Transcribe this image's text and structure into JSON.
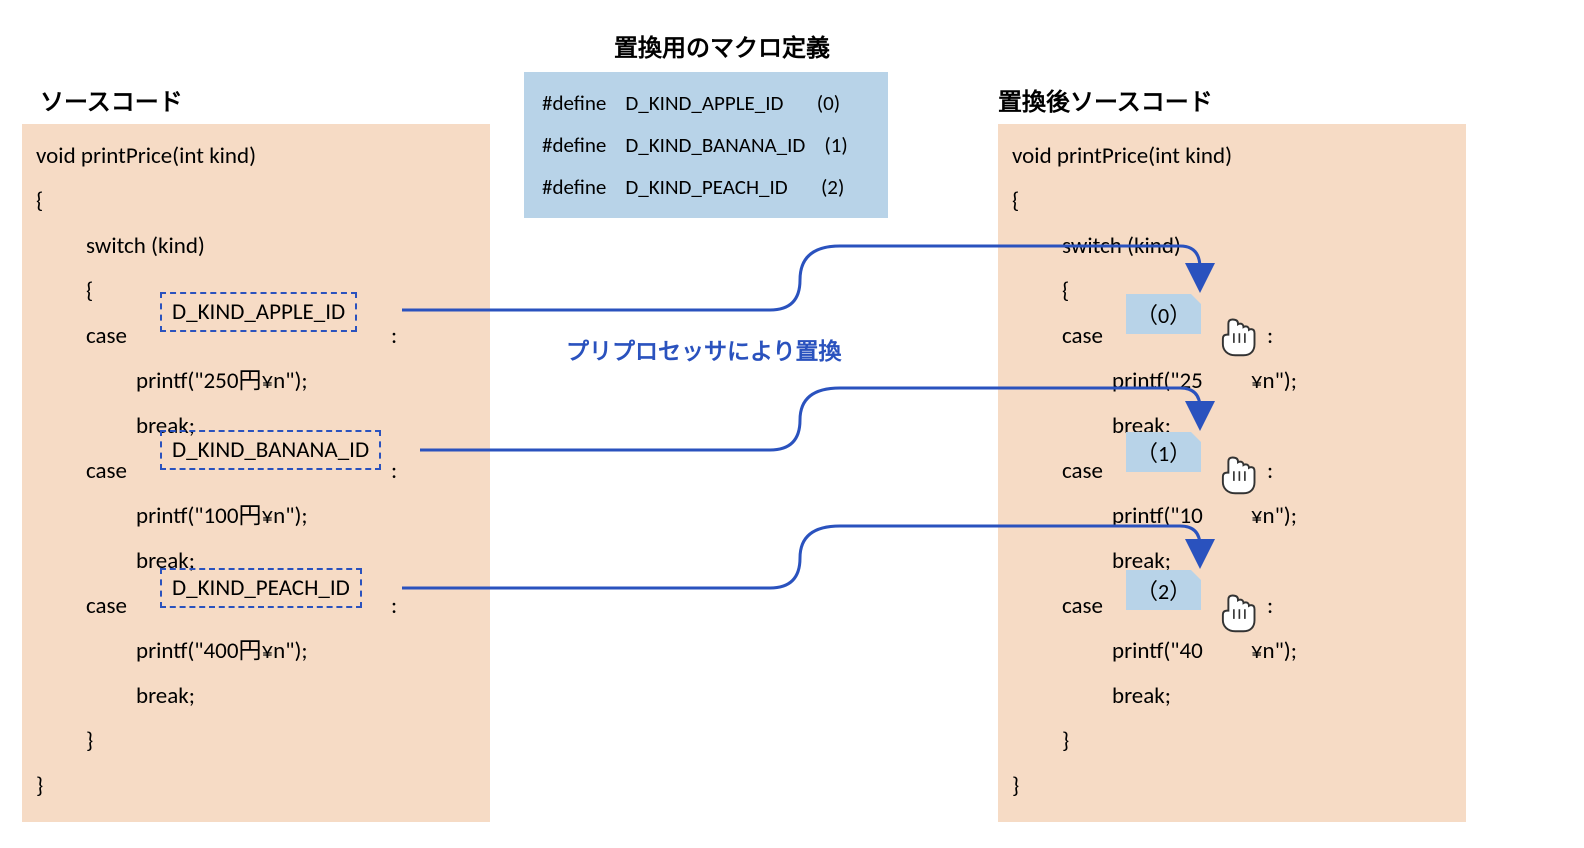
{
  "titles": {
    "source": "ソースコード",
    "defines": "置換用のマクロ定義",
    "result": "置換後ソースコード"
  },
  "note": "プリプロセッサにより置換",
  "defines": [
    {
      "keyword": "#define",
      "name": "D_KIND_APPLE_ID",
      "value": "(0)"
    },
    {
      "keyword": "#define",
      "name": "D_KIND_BANANA_ID",
      "value": "(1)"
    },
    {
      "keyword": "#define",
      "name": "D_KIND_PEACH_ID",
      "value": "(2)"
    }
  ],
  "source": {
    "func_sig": "void printPrice(int kind)",
    "open": "{",
    "switch": "switch (kind)",
    "sw_open": "{",
    "case_kw": "case",
    "colon": ":",
    "macros": [
      "D_KIND_APPLE_ID",
      "D_KIND_BANANA_ID",
      "D_KIND_PEACH_ID"
    ],
    "printfs": [
      "printf(\"250円¥n\");",
      "printf(\"100円¥n\");",
      "printf(\"400円¥n\");"
    ],
    "break": "break;",
    "sw_close": "}",
    "close": "}"
  },
  "result": {
    "func_sig": "void printPrice(int kind)",
    "open": "{",
    "switch": "switch (kind)",
    "sw_open": "{",
    "case_kw": "case",
    "colon": ":",
    "values": [
      "（0）",
      "（1）",
      "（2）"
    ],
    "printfs_parts": [
      {
        "pre": "printf(\"25",
        "post": "¥n\");"
      },
      {
        "pre": "printf(\"10",
        "post": "¥n\");"
      },
      {
        "pre": "printf(\"40",
        "post": "¥n\");"
      }
    ],
    "break": "break;",
    "sw_close": "}",
    "close": "}"
  }
}
